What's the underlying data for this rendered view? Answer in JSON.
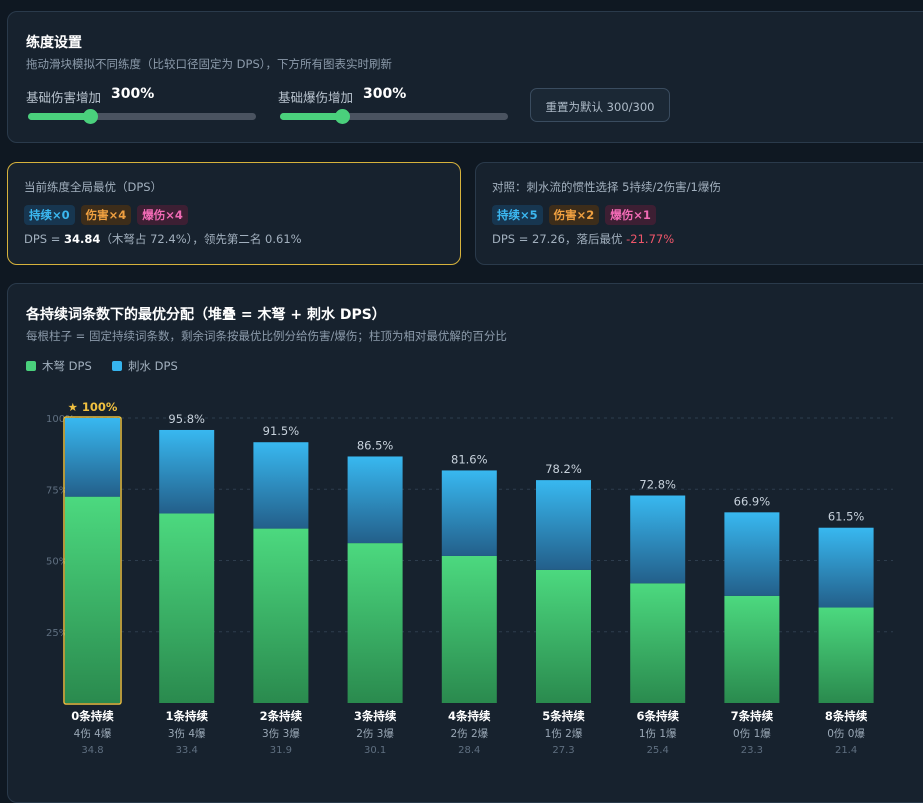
{
  "settings": {
    "title": "练度设置",
    "subtitle": "拖动滑块模拟不同练度（比较口径固定为 DPS），下方所有图表实时刷新",
    "base_damage_label": "基础伤害增加",
    "base_damage_value": "300%",
    "base_damage_fraction": 0.27,
    "base_crit_label": "基础爆伤增加",
    "base_crit_value": "300%",
    "base_crit_fraction": 0.27,
    "reset_label": "重置为默认 300/300"
  },
  "best_card": {
    "title": "当前练度全局最优（DPS）",
    "tags": [
      "持续×0",
      "伤害×4",
      "爆伤×4"
    ],
    "dps_prefix": "DPS = ",
    "dps_value": "34.84",
    "dps_suffix": "（木弩占 72.4%），领先第二名 0.61%"
  },
  "compare_card": {
    "title": "对照：刺水流的惯性选择 5持续/2伤害/1爆伤",
    "tags": [
      "持续×5",
      "伤害×2",
      "爆伤×1"
    ],
    "dps_prefix": "DPS = 27.26，落后最优 ",
    "dps_diff": "-21.77%"
  },
  "chart_panel": {
    "title": "各持续词条数下的最优分配（堆叠 = 木弩 + 刺水 DPS）",
    "subtitle": "每根柱子 = 固定持续词条数，剩余词条按最优比例分给伤害/爆伤；柱顶为相对最优解的百分比",
    "legend": [
      {
        "name": "木弩 DPS",
        "color": "#4ad07c"
      },
      {
        "name": "刺水 DPS",
        "color": "#36b4ee"
      }
    ]
  },
  "chart_data": {
    "type": "bar",
    "stacked": true,
    "ylim": [
      0,
      100
    ],
    "yticks": [
      "25%",
      "50%",
      "75%",
      "100%"
    ],
    "ytick_values": [
      25,
      50,
      75,
      100
    ],
    "grid": true,
    "legend_position": "top-left",
    "categories": [
      "0条持续",
      "1条持续",
      "2条持续",
      "3条持续",
      "4条持续",
      "5条持续",
      "6条持续",
      "7条持续",
      "8条持续"
    ],
    "sublabels": [
      "4伤 4爆",
      "3伤 4爆",
      "3伤 3爆",
      "2伤 3爆",
      "2伤 2爆",
      "1伤 2爆",
      "1伤 1爆",
      "0伤 1爆",
      "0伤 0爆"
    ],
    "dps_labels": [
      "34.8",
      "33.4",
      "31.9",
      "30.1",
      "28.4",
      "27.3",
      "25.4",
      "23.3",
      "21.4"
    ],
    "top_labels": [
      "★ 100%",
      "95.8%",
      "91.5%",
      "86.5%",
      "81.6%",
      "78.2%",
      "72.8%",
      "66.9%",
      "61.5%"
    ],
    "highlight_index": 0,
    "series": [
      {
        "name": "木弩 DPS",
        "color": "#4ad07c",
        "values": [
          72.4,
          66.5,
          61.2,
          56.1,
          51.6,
          46.7,
          42.0,
          37.6,
          33.5
        ]
      },
      {
        "name": "刺水 DPS",
        "color": "#36b4ee",
        "values": [
          27.6,
          29.3,
          30.3,
          30.4,
          30.0,
          31.5,
          30.8,
          29.3,
          28.0
        ]
      }
    ]
  }
}
